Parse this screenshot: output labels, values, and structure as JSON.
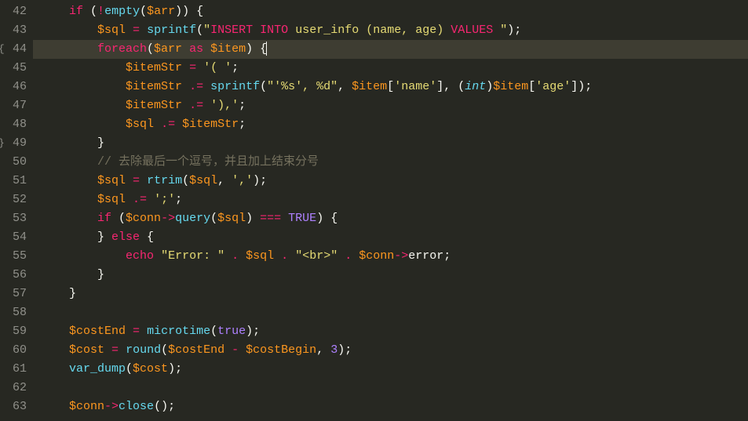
{
  "gutter": {
    "lines": [
      "42",
      "43",
      "44",
      "45",
      "46",
      "47",
      "48",
      "49",
      "50",
      "51",
      "52",
      "53",
      "54",
      "55",
      "56",
      "57",
      "58",
      "59",
      "60",
      "61",
      "62",
      "63"
    ],
    "folds": {
      "44": "{",
      "49": "}"
    },
    "highlighted": "44"
  },
  "code": {
    "l42": {
      "indent": "    ",
      "kw1": "if",
      "p1": " (",
      "op1": "!",
      "fn1": "empty",
      "p2": "(",
      "var1": "$arr",
      "p3": ")) {"
    },
    "l43": {
      "indent": "        ",
      "var1": "$sql",
      "p1": " ",
      "op1": "=",
      "p2": " ",
      "fn1": "sprintf",
      "p3": "(",
      "sq1": "\"",
      "skw1": "INSERT",
      "sp1": " ",
      "skw2": "INTO",
      "sp2": " ",
      "stxt1": "user_info (name, age) ",
      "skw3": "VALUES",
      "sp3": " ",
      "sq2": "\"",
      "p4": ");"
    },
    "l44": {
      "indent": "        ",
      "kw1": "foreach",
      "p1": "(",
      "var1": "$arr",
      "p2": " ",
      "kw2": "as",
      "p3": " ",
      "var2": "$item",
      "p4": ") {"
    },
    "l45": {
      "indent": "            ",
      "var1": "$itemStr",
      "p1": " ",
      "op1": "=",
      "p2": " ",
      "str1": "'( '",
      "p3": ";"
    },
    "l46": {
      "indent": "            ",
      "var1": "$itemStr",
      "p1": " ",
      "op1": ".=",
      "p2": " ",
      "fn1": "sprintf",
      "p3": "(",
      "str1": "\"'%s', %d\"",
      "p4": ", ",
      "var2": "$item",
      "p5": "[",
      "str2": "'name'",
      "p6": "], (",
      "type1": "int",
      "p7": ")",
      "var3": "$item",
      "p8": "[",
      "str3": "'age'",
      "p9": "]);"
    },
    "l47": {
      "indent": "            ",
      "var1": "$itemStr",
      "p1": " ",
      "op1": ".=",
      "p2": " ",
      "str1": "'),'",
      "p3": ";"
    },
    "l48": {
      "indent": "            ",
      "var1": "$sql",
      "p1": " ",
      "op1": ".=",
      "p2": " ",
      "var2": "$itemStr",
      "p3": ";"
    },
    "l49": {
      "indent": "        ",
      "p1": "}"
    },
    "l50": {
      "indent": "        ",
      "comment": "// 去除最后一个逗号，并且加上结束分号"
    },
    "l51": {
      "indent": "        ",
      "var1": "$sql",
      "p1": " ",
      "op1": "=",
      "p2": " ",
      "fn1": "rtrim",
      "p3": "(",
      "var2": "$sql",
      "p4": ", ",
      "str1": "','",
      "p5": ");"
    },
    "l52": {
      "indent": "        ",
      "var1": "$sql",
      "p1": " ",
      "op1": ".=",
      "p2": " ",
      "str1": "';'",
      "p3": ";"
    },
    "l53": {
      "indent": "        ",
      "kw1": "if",
      "p1": " (",
      "var1": "$conn",
      "op1": "->",
      "fn1": "query",
      "p2": "(",
      "var2": "$sql",
      "p3": ") ",
      "op2": "===",
      "p4": " ",
      "const1": "TRUE",
      "p5": ") {"
    },
    "l54": {
      "indent": "        ",
      "p1": "} ",
      "kw1": "else",
      "p2": " {"
    },
    "l55": {
      "indent": "            ",
      "kw1": "echo",
      "p1": " ",
      "str1": "\"Error: \"",
      "p2": " ",
      "op1": ".",
      "p3": " ",
      "var1": "$sql",
      "p4": " ",
      "op2": ".",
      "p5": " ",
      "str2": "\"<br>\"",
      "p6": " ",
      "op3": ".",
      "p7": " ",
      "var2": "$conn",
      "op4": "->",
      "prop1": "error",
      "p8": ";"
    },
    "l56": {
      "indent": "        ",
      "p1": "}"
    },
    "l57": {
      "indent": "    ",
      "p1": "}"
    },
    "l58": {
      "indent": ""
    },
    "l59": {
      "indent": "    ",
      "var1": "$costEnd",
      "p1": " ",
      "op1": "=",
      "p2": " ",
      "fn1": "microtime",
      "p3": "(",
      "const1": "true",
      "p4": ");"
    },
    "l60": {
      "indent": "    ",
      "var1": "$cost",
      "p1": " ",
      "op1": "=",
      "p2": " ",
      "fn1": "round",
      "p3": "(",
      "var2": "$costEnd",
      "p4": " ",
      "op2": "-",
      "p5": " ",
      "var3": "$costBegin",
      "p6": ", ",
      "num1": "3",
      "p7": ");"
    },
    "l61": {
      "indent": "    ",
      "fn1": "var_dump",
      "p1": "(",
      "var1": "$cost",
      "p2": ");"
    },
    "l62": {
      "indent": ""
    },
    "l63": {
      "indent": "    ",
      "var1": "$conn",
      "op1": "->",
      "fn1": "close",
      "p1": "();"
    }
  }
}
